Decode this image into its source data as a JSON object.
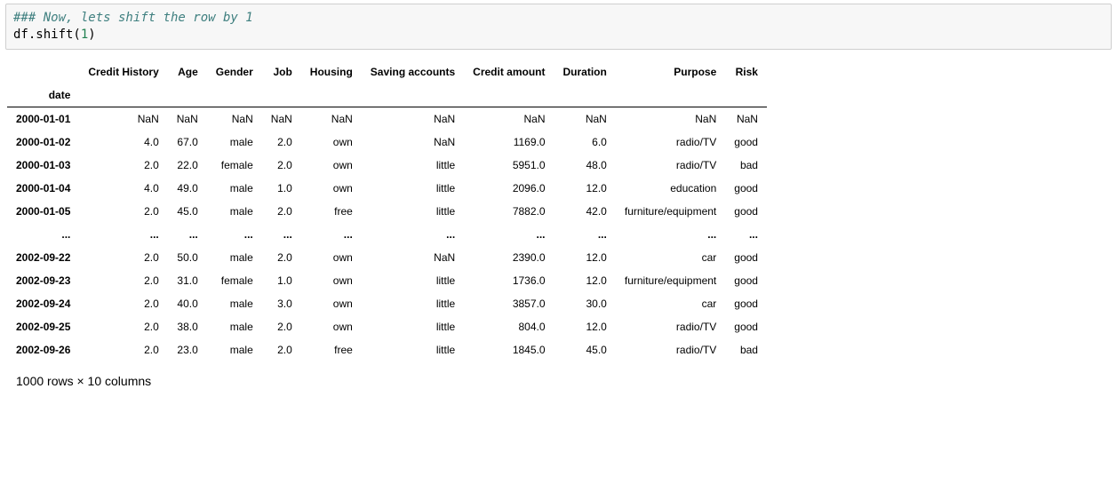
{
  "code": {
    "comment": "### Now, lets shift the row by 1",
    "line": "df.shift(",
    "arg": "1",
    "close": ")"
  },
  "table": {
    "index_name": "date",
    "columns": [
      "Credit History",
      "Age",
      "Gender",
      "Job",
      "Housing",
      "Saving accounts",
      "Credit amount",
      "Duration",
      "Purpose",
      "Risk"
    ],
    "rows": [
      {
        "idx": "2000-01-01",
        "cells": [
          "NaN",
          "NaN",
          "NaN",
          "NaN",
          "NaN",
          "NaN",
          "NaN",
          "NaN",
          "NaN",
          "NaN"
        ]
      },
      {
        "idx": "2000-01-02",
        "cells": [
          "4.0",
          "67.0",
          "male",
          "2.0",
          "own",
          "NaN",
          "1169.0",
          "6.0",
          "radio/TV",
          "good"
        ]
      },
      {
        "idx": "2000-01-03",
        "cells": [
          "2.0",
          "22.0",
          "female",
          "2.0",
          "own",
          "little",
          "5951.0",
          "48.0",
          "radio/TV",
          "bad"
        ]
      },
      {
        "idx": "2000-01-04",
        "cells": [
          "4.0",
          "49.0",
          "male",
          "1.0",
          "own",
          "little",
          "2096.0",
          "12.0",
          "education",
          "good"
        ]
      },
      {
        "idx": "2000-01-05",
        "cells": [
          "2.0",
          "45.0",
          "male",
          "2.0",
          "free",
          "little",
          "7882.0",
          "42.0",
          "furniture/equipment",
          "good"
        ]
      },
      {
        "idx": "...",
        "cells": [
          "...",
          "...",
          "...",
          "...",
          "...",
          "...",
          "...",
          "...",
          "...",
          "..."
        ],
        "ellipsis": true
      },
      {
        "idx": "2002-09-22",
        "cells": [
          "2.0",
          "50.0",
          "male",
          "2.0",
          "own",
          "NaN",
          "2390.0",
          "12.0",
          "car",
          "good"
        ]
      },
      {
        "idx": "2002-09-23",
        "cells": [
          "2.0",
          "31.0",
          "female",
          "1.0",
          "own",
          "little",
          "1736.0",
          "12.0",
          "furniture/equipment",
          "good"
        ]
      },
      {
        "idx": "2002-09-24",
        "cells": [
          "2.0",
          "40.0",
          "male",
          "3.0",
          "own",
          "little",
          "3857.0",
          "30.0",
          "car",
          "good"
        ]
      },
      {
        "idx": "2002-09-25",
        "cells": [
          "2.0",
          "38.0",
          "male",
          "2.0",
          "own",
          "little",
          "804.0",
          "12.0",
          "radio/TV",
          "good"
        ]
      },
      {
        "idx": "2002-09-26",
        "cells": [
          "2.0",
          "23.0",
          "male",
          "2.0",
          "free",
          "little",
          "1845.0",
          "45.0",
          "radio/TV",
          "bad"
        ]
      }
    ],
    "dims": "1000 rows × 10 columns"
  }
}
